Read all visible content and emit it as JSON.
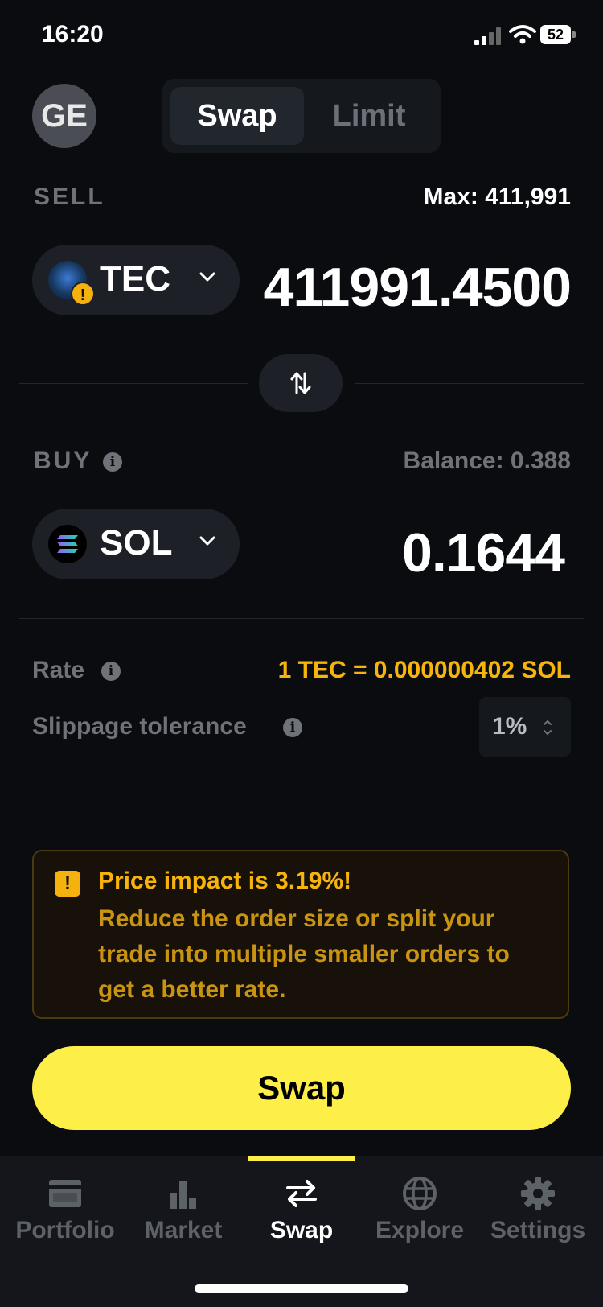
{
  "status": {
    "time": "16:20",
    "battery": "52"
  },
  "header": {
    "avatar": "GE",
    "tabs": [
      "Swap",
      "Limit"
    ],
    "active_tab": "Swap"
  },
  "sell": {
    "label": "SELL",
    "max": "Max: 411,991",
    "token": "TEC",
    "amount": "411991.4500",
    "token_warning": "!"
  },
  "buy": {
    "label": "BUY",
    "balance": "Balance: 0.388",
    "token": "SOL",
    "amount": "0.1644"
  },
  "info": {
    "rate_label": "Rate",
    "rate_value": "1 TEC = 0.000000402 SOL",
    "slippage_label": "Slippage tolerance",
    "slippage_value": "1%"
  },
  "warning": {
    "icon": "!",
    "title": "Price impact is 3.19%!",
    "body": "Reduce the order size or split your trade into multiple smaller orders to get a better rate."
  },
  "swap_button": "Swap",
  "nav": {
    "items": [
      {
        "label": "Portfolio",
        "icon": "wallet-icon"
      },
      {
        "label": "Market",
        "icon": "bar-chart-icon"
      },
      {
        "label": "Swap",
        "icon": "swap-arrows-icon"
      },
      {
        "label": "Explore",
        "icon": "globe-icon"
      },
      {
        "label": "Settings",
        "icon": "gear-icon"
      }
    ],
    "active": "Swap"
  },
  "colors": {
    "accent": "#fdef47",
    "warning": "#f6b40d",
    "background": "#0a0c10"
  }
}
